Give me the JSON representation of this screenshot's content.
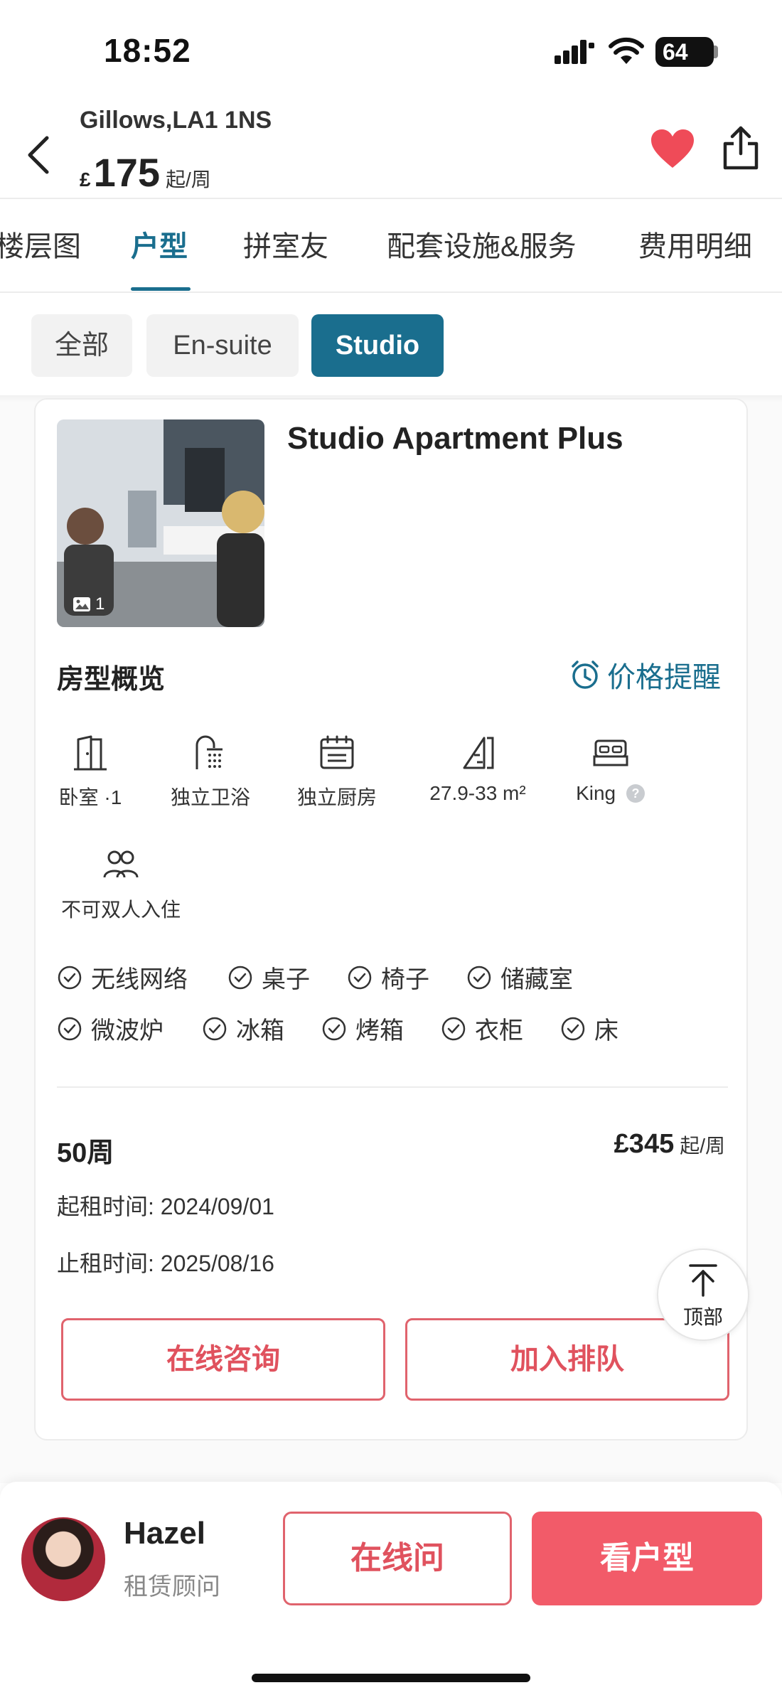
{
  "status_bar": {
    "time": "18:52",
    "battery": "64"
  },
  "header": {
    "address": "Gillows,LA1 1NS",
    "price_currency": "£",
    "price_amount": "175",
    "price_unit": "起/周"
  },
  "tabs": [
    {
      "label": "楼层图"
    },
    {
      "label": "户型",
      "active": true
    },
    {
      "label": "拼室友"
    },
    {
      "label": "配套设施&服务"
    },
    {
      "label": "费用明细"
    }
  ],
  "filters": [
    {
      "label": "全部"
    },
    {
      "label": "En-suite"
    },
    {
      "label": "Studio",
      "active": true
    }
  ],
  "room": {
    "title": "Studio Apartment Plus",
    "photo_count": "1",
    "overview_title": "房型概览",
    "price_alert": "价格提醒",
    "features": [
      {
        "icon": "door-icon",
        "label": "卧室 ·1"
      },
      {
        "icon": "shower-icon",
        "label": "独立卫浴"
      },
      {
        "icon": "kitchen-icon",
        "label": "独立厨房"
      },
      {
        "icon": "area-icon",
        "label": "27.9-33 m²"
      },
      {
        "icon": "bed-icon",
        "label": "King"
      },
      {
        "icon": "people-icon",
        "label": "不可双人入住"
      }
    ],
    "amenities_row1": [
      "无线网络",
      "桌子",
      "椅子",
      "储藏室"
    ],
    "amenities_row2": [
      "微波炉",
      "冰箱",
      "烤箱",
      "衣柜",
      "床"
    ],
    "lease": {
      "weeks": "50周",
      "price": "£345",
      "price_unit": "起/周",
      "start_label": "起租时间:",
      "start_date": "2024/09/01",
      "end_label": "止租时间:",
      "end_date": "2025/08/16"
    },
    "consult_button": "在线咨询",
    "queue_button": "加入排队"
  },
  "back_to_top": "顶部",
  "agent": {
    "name": "Hazel",
    "role": "租赁顾问",
    "ask_button": "在线问",
    "view_button": "看户型"
  },
  "colors": {
    "accent": "#1a6e8e",
    "primary_red": "#f25b69",
    "heart": "#ef4b58"
  }
}
